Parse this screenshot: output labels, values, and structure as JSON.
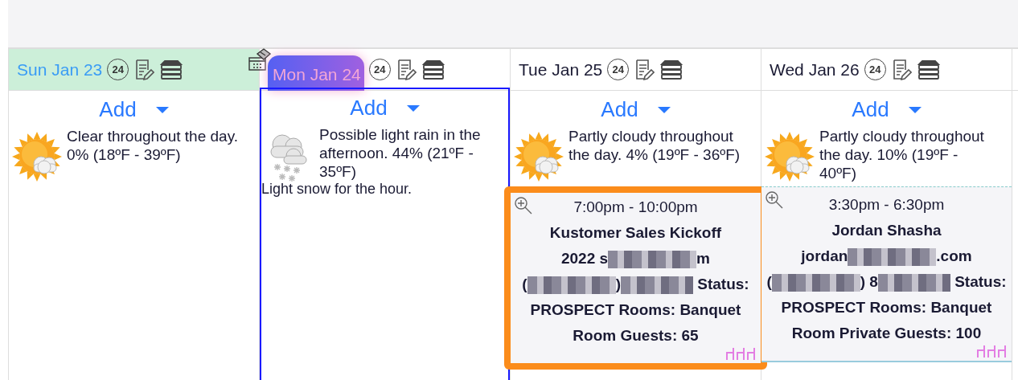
{
  "days": [
    {
      "label": "Sun Jan 23",
      "kind": "weekend",
      "hours": "24",
      "add": "Add",
      "weather": {
        "kind": "partly_cloudy",
        "text": "Clear throughout the day. 0% (18ºF - 39ºF)"
      }
    },
    {
      "label": "Mon Jan 24",
      "kind": "today",
      "hours": "24",
      "add": "Add",
      "weather": {
        "kind": "snow",
        "text": "Possible light rain in the afternoon. 44% (21ºF - 35ºF)",
        "note": "Light snow for the hour."
      }
    },
    {
      "label": "Tue Jan 25",
      "kind": "normal",
      "hours": "24",
      "add": "Add",
      "weather": {
        "kind": "partly_cloudy",
        "text": "Partly cloudy throughout the day. 4% (19ºF - 36ºF)"
      },
      "events": [
        {
          "time": "7:00pm - 10:00pm",
          "title": "Kustomer Sales Kickoff",
          "selected": true,
          "lines": [
            [
              {
                "kind": "text",
                "text": "2022 s"
              },
              {
                "kind": "redacted"
              },
              {
                "kind": "text",
                "text": "m"
              }
            ],
            [
              {
                "kind": "text",
                "text": "("
              },
              {
                "kind": "redacted"
              },
              {
                "kind": "text",
                "text": ")"
              },
              {
                "kind": "redacted"
              },
              {
                "kind": "text",
                "text": " Status:"
              }
            ],
            [
              {
                "kind": "text",
                "text": "PROSPECT Rooms: Banquet"
              }
            ],
            [
              {
                "kind": "text",
                "text": "Room Guests: 65"
              }
            ]
          ]
        }
      ]
    },
    {
      "label": "Wed Jan 26",
      "kind": "normal",
      "hours": "24",
      "add": "Add",
      "weather": {
        "kind": "partly_cloudy",
        "text": "Partly cloudy throughout the day. 10% (19ºF - 40ºF)"
      },
      "events": [
        {
          "time": "3:30pm - 6:30pm",
          "title": "Jordan Shasha",
          "selected": false,
          "lines": [
            [
              {
                "kind": "text",
                "text": "jordan"
              },
              {
                "kind": "redacted"
              },
              {
                "kind": "text",
                "text": ".com"
              }
            ],
            [
              {
                "kind": "text",
                "text": "("
              },
              {
                "kind": "redacted"
              },
              {
                "kind": "text",
                "text": ") 8"
              },
              {
                "kind": "redacted"
              },
              {
                "kind": "text",
                "text": " Status:"
              }
            ],
            [
              {
                "kind": "text",
                "text": "PROSPECT Rooms: Banquet"
              }
            ],
            [
              {
                "kind": "text",
                "text": "Room Private Guests: 100"
              }
            ]
          ]
        }
      ]
    }
  ]
}
